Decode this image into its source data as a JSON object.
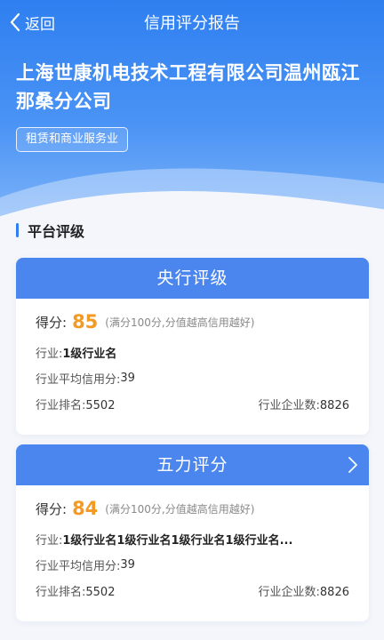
{
  "topbar": {
    "back_label": "返回",
    "title": "信用评分报告"
  },
  "company": {
    "name": "上海世康机电技术工程有限公司温州瓯江那桑分公司",
    "industry_tag": "租赁和商业服务业"
  },
  "section": {
    "title": "平台评级"
  },
  "cards": [
    {
      "title": "央行评级",
      "score_label": "得分:",
      "score": "85",
      "score_note": "(满分100分,分值越高信用越好)",
      "industry_label": "行业:",
      "industry_value": "1级行业名",
      "avg_label": "行业平均信用分:",
      "avg_value": "39",
      "rank_label": "行业排名:",
      "rank_value": "5502",
      "count_label": "行业企业数:",
      "count_value": "8826"
    },
    {
      "title": "五力评分",
      "score_label": "得分:",
      "score": "84",
      "score_note": "(满分100分,分值越高信用越好)",
      "industry_label": "行业:",
      "industry_value": "1级行业名1级行业名1级行业名1级行业名...",
      "avg_label": "行业平均信用分:",
      "avg_value": "39",
      "rank_label": "行业排名:",
      "rank_value": "5502",
      "count_label": "行业企业数:",
      "count_value": "8826"
    }
  ],
  "colors": {
    "primary": "#2f7ff0",
    "card_head": "#4a86ee",
    "score": "#f39a25"
  },
  "icons": {
    "back": "chevron-left-icon",
    "more": "chevron-right-icon"
  }
}
